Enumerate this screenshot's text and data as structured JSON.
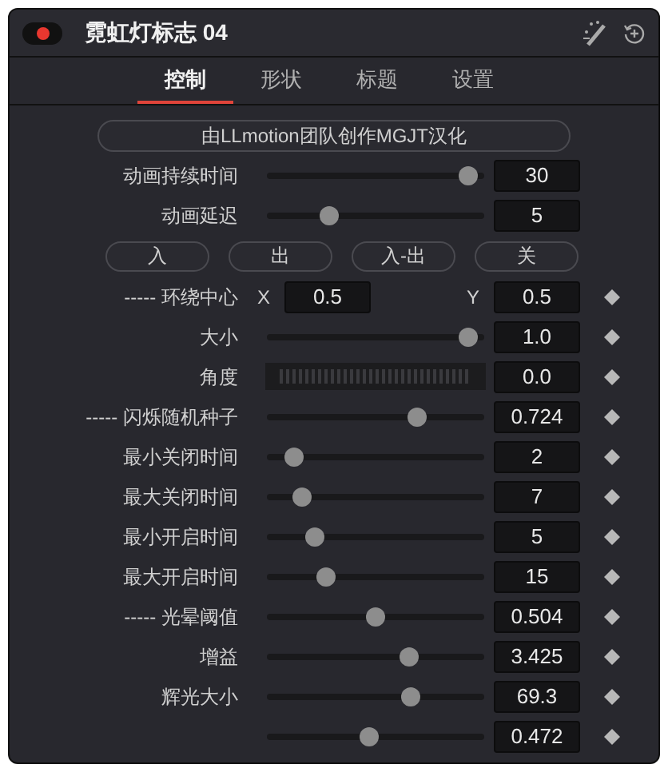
{
  "header": {
    "enabled": true,
    "title": "霓虹灯标志 04"
  },
  "tabs": [
    {
      "label": "控制",
      "selected": true
    },
    {
      "label": "形状",
      "selected": false
    },
    {
      "label": "标题",
      "selected": false
    },
    {
      "label": "设置",
      "selected": false
    }
  ],
  "credit_button": "由LLmotion团队创作MGJT汉化",
  "rows": [
    {
      "kind": "slider",
      "label": "动画持续时间",
      "level": 0.97,
      "value": "30",
      "keyframe": false
    },
    {
      "kind": "slider",
      "label": "动画延迟",
      "level": 0.27,
      "value": "5",
      "keyframe": false
    },
    {
      "kind": "buttons",
      "buttons": [
        "入",
        "出",
        "入-出",
        "关"
      ]
    },
    {
      "kind": "xy",
      "label": "----- 环绕中心",
      "x_label": "X",
      "x_value": "0.5",
      "y_label": "Y",
      "y_value": "0.5",
      "keyframe": true
    },
    {
      "kind": "slider",
      "label": "大小",
      "level": 0.97,
      "value": "1.0",
      "keyframe": true
    },
    {
      "kind": "dial",
      "label": "角度",
      "value": "0.0",
      "keyframe": true
    },
    {
      "kind": "slider",
      "label": "----- 闪烁随机种子",
      "level": 0.71,
      "value": "0.724",
      "keyframe": true
    },
    {
      "kind": "slider",
      "label": "最小关闭时间",
      "level": 0.09,
      "value": "2",
      "keyframe": true
    },
    {
      "kind": "slider",
      "label": "最大关闭时间",
      "level": 0.13,
      "value": "7",
      "keyframe": true
    },
    {
      "kind": "slider",
      "label": "最小开启时间",
      "level": 0.19,
      "value": "5",
      "keyframe": true
    },
    {
      "kind": "slider",
      "label": "最大开启时间",
      "level": 0.25,
      "value": "15",
      "keyframe": true
    },
    {
      "kind": "slider",
      "label": "----- 光晕阈值",
      "level": 0.5,
      "value": "0.504",
      "keyframe": true
    },
    {
      "kind": "slider",
      "label": "增益",
      "level": 0.67,
      "value": "3.425",
      "keyframe": true
    },
    {
      "kind": "slider",
      "label": "辉光大小",
      "level": 0.68,
      "value": "69.3",
      "keyframe": true
    },
    {
      "kind": "slider",
      "level": 0.47,
      "value": "0.472",
      "keyframe": true
    }
  ]
}
